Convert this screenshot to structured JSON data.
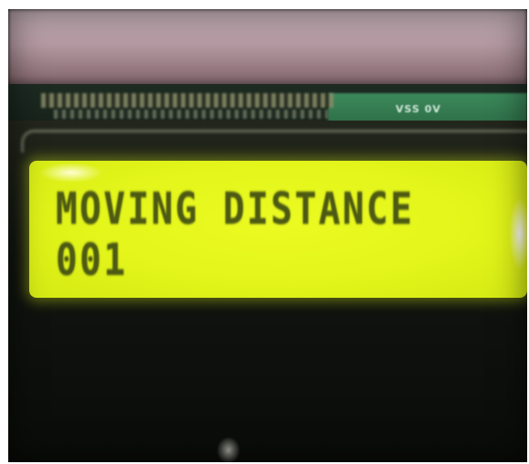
{
  "pcb": {
    "label": "VSS 0V"
  },
  "lcd": {
    "line1": "MOVING DISTANCE",
    "line2": "001",
    "backlight_color": "#e6f71c",
    "text_color": "#4d5a13"
  }
}
